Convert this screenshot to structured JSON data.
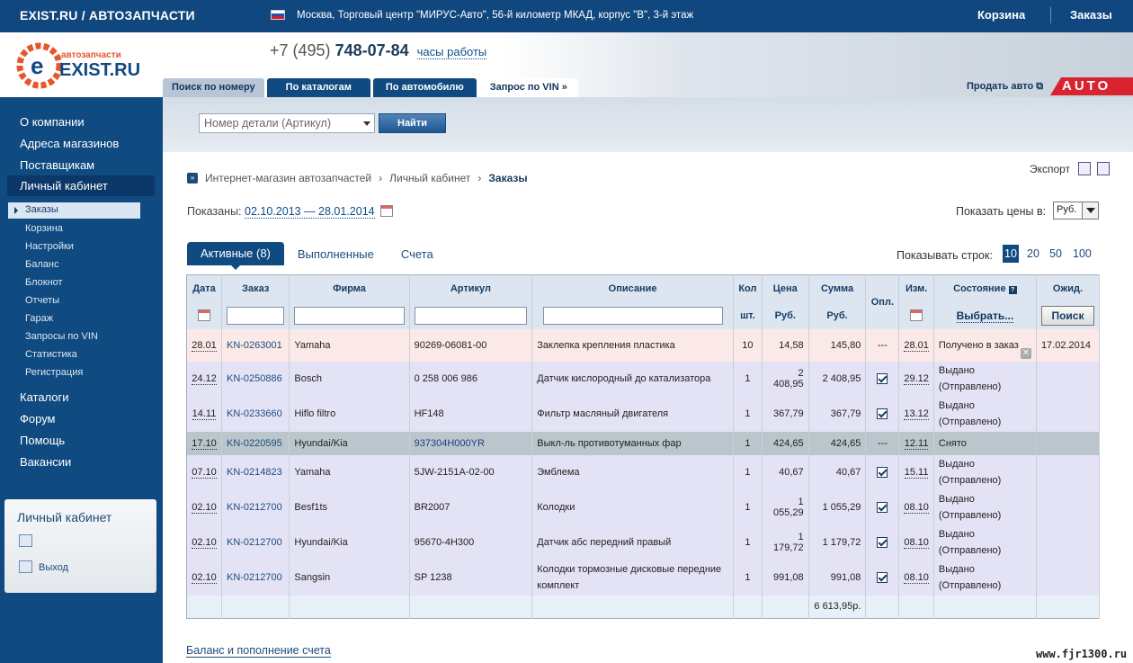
{
  "topbar": {
    "brand": "EXIST.RU / АВТОЗАПЧАСТИ",
    "address": "Москва, Торговый центр \"МИРУС-Авто\", 56-й километр МКАД, корпус \"В\", 3-й этаж",
    "cart": "Корзина",
    "orders": "Заказы"
  },
  "header": {
    "logo_sub": "автозапчасти",
    "logo_main": "EXIST.RU",
    "phone_prefix": "+7 (495)",
    "phone_number": "748-07-84",
    "hours": "часы работы",
    "tabs": [
      "Поиск по номеру",
      "По каталогам",
      "По автомобилю",
      "Запрос по VIN »"
    ],
    "sell": "Продать авто",
    "auto_banner": "AUTO"
  },
  "search": {
    "select_value": "Номер детали (Артикул)",
    "button": "Найти"
  },
  "sidebar": {
    "top_items": [
      "О компании",
      "Адреса магазинов",
      "Поставщикам",
      "Личный кабинет"
    ],
    "sub_items": [
      "Заказы",
      "Корзина",
      "Настройки",
      "Баланс",
      "Блокнот",
      "Отчеты",
      "Гараж",
      "Запросы по VIN",
      "Статистика",
      "Регистрация"
    ],
    "bottom_items": [
      "Каталоги",
      "Форум",
      "Помощь",
      "Вакансии"
    ],
    "box_title": "Личный кабинет",
    "exit": "Выход"
  },
  "breadcrumb": {
    "items": [
      "Интернет-магазин автозапчастей",
      "Личный кабинет",
      "Заказы"
    ],
    "sep": "›"
  },
  "export": "Экспорт",
  "shown": {
    "label": "Показаны:",
    "range": "02.10.2013 — 28.01.2014"
  },
  "price_currency": {
    "label": "Показать цены в:",
    "value": "Руб."
  },
  "tabs": [
    "Активные (8)",
    "Выполненные",
    "Счета"
  ],
  "rows_per_page": {
    "label": "Показывать строк:",
    "options": [
      "10",
      "20",
      "50",
      "100"
    ],
    "selected": "10"
  },
  "table": {
    "headers": [
      "Дата",
      "Заказ",
      "Фирма",
      "Артикул",
      "Описание",
      "Кол",
      "Цена",
      "Сумма",
      "Опл.",
      "Изм.",
      "Состояние",
      "Ожид."
    ],
    "subheaders": {
      "qty": "шт.",
      "price": "Руб.",
      "sum": "Руб.",
      "state_filter": "Выбрать...",
      "search": "Поиск"
    },
    "rows": [
      {
        "date": "28.01",
        "order": "KN-0263001",
        "brand": "Yamaha",
        "article": "90269-06081-00",
        "desc": "Заклепка крепления пластика",
        "qty": "10",
        "price": "14,58",
        "sum": "145,80",
        "paid": "---",
        "changed": "28.01",
        "state1": "Получено в заказ",
        "state2": "",
        "expected": "17.02.2014"
      },
      {
        "date": "24.12",
        "order": "KN-0250886",
        "brand": "Bosch",
        "article": "0 258 006 986",
        "desc": "Датчик кислородный до катализатора",
        "qty": "1",
        "price": "2 408,95",
        "sum": "2 408,95",
        "paid": "check",
        "changed": "29.12",
        "state1": "Выдано",
        "state2": "(Отправлено)",
        "expected": ""
      },
      {
        "date": "14.11",
        "order": "KN-0233660",
        "brand": "Hiflo filtro",
        "article": "HF148",
        "desc": "Фильтр масляный двигателя",
        "qty": "1",
        "price": "367,79",
        "sum": "367,79",
        "paid": "check",
        "changed": "13.12",
        "state1": "Выдано",
        "state2": "(Отправлено)",
        "expected": ""
      },
      {
        "date": "17.10",
        "order": "KN-0220595",
        "brand": "Hyundai/Kia",
        "article": "937304H000YR",
        "desc": "Выкл-ль противотуманных фар",
        "qty": "1",
        "price": "424,65",
        "sum": "424,65",
        "paid": "---",
        "changed": "12.11",
        "state1": "Снято",
        "state2": "",
        "expected": ""
      },
      {
        "date": "07.10",
        "order": "KN-0214823",
        "brand": "Yamaha",
        "article": "5JW-2151A-02-00",
        "desc": "Эмблема",
        "qty": "1",
        "price": "40,67",
        "sum": "40,67",
        "paid": "check",
        "changed": "15.11",
        "state1": "Выдано",
        "state2": "(Отправлено)",
        "expected": ""
      },
      {
        "date": "02.10",
        "order": "KN-0212700",
        "brand": "Besf1ts",
        "article": "BR2007",
        "desc": "Колодки",
        "qty": "1",
        "price": "1 055,29",
        "sum": "1 055,29",
        "paid": "check",
        "changed": "08.10",
        "state1": "Выдано",
        "state2": "(Отправлено)",
        "expected": ""
      },
      {
        "date": "02.10",
        "order": "KN-0212700",
        "brand": "Hyundai/Kia",
        "article": "95670-4H300",
        "desc": "Датчик абс передний правый",
        "qty": "1",
        "price": "1 179,72",
        "sum": "1 179,72",
        "paid": "check",
        "changed": "08.10",
        "state1": "Выдано",
        "state2": "(Отправлено)",
        "expected": ""
      },
      {
        "date": "02.10",
        "order": "KN-0212700",
        "brand": "Sangsin",
        "article": "SP 1238",
        "desc": "Колодки тормозные дисковые передние комплект",
        "qty": "1",
        "price": "991,08",
        "sum": "991,08",
        "paid": "check",
        "changed": "08.10",
        "state1": "Выдано",
        "state2": "(Отправлено)",
        "expected": ""
      }
    ],
    "total": "6 613,95р."
  },
  "balance_link": "Баланс и пополнение счета",
  "watermark": "www.fjr1300.ru",
  "colors": {
    "brand_blue": "#0f4a80",
    "auto_red": "#d9232e",
    "row_highlight": "#fbe9e8",
    "row_normal": "#e4e3f6",
    "row_cancelled": "#bbc6cc"
  }
}
